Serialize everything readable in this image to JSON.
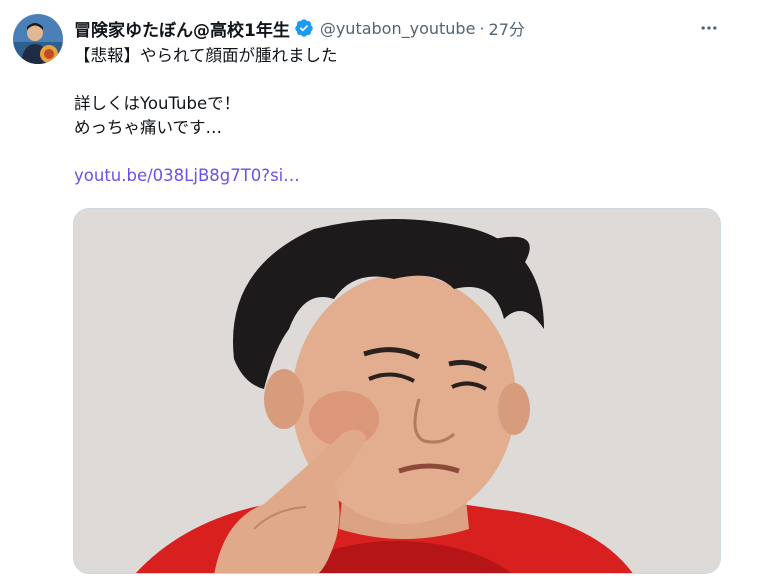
{
  "tweet": {
    "display_name": "冒険家ゆたぼん@高校1年生",
    "handle": "@yutabon_youtube",
    "separator": "·",
    "time": "27分",
    "lines": {
      "line1": "【悲報】やられて顔面が腫れました",
      "line2": "詳しくはYouTubeで！",
      "line3": "めっちゃ痛いです…"
    },
    "link_text": "youtu.be/038LjB8g7T0?si…"
  },
  "icons": {
    "verified": "verified-badge-icon",
    "more": "more-options-icon"
  },
  "colors": {
    "text": "#0f1419",
    "secondary": "#536471",
    "verified": "#1d9bf0",
    "link": "#6b52e6"
  }
}
